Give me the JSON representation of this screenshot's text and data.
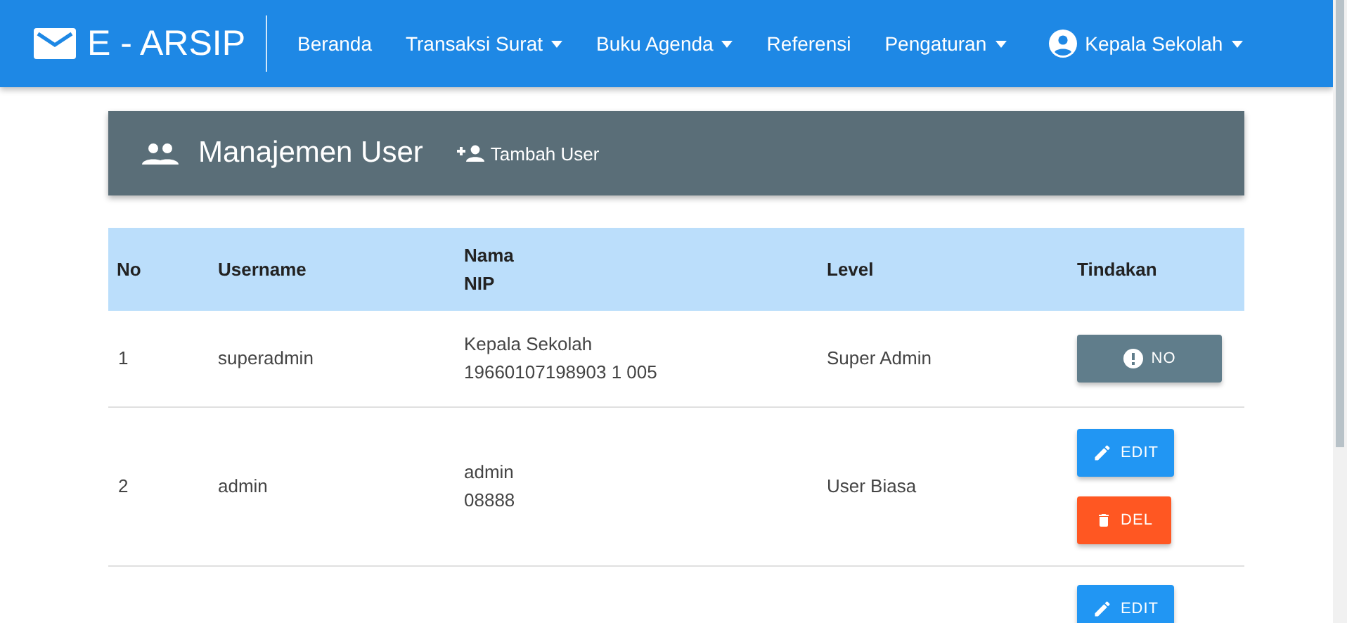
{
  "navbar": {
    "brand": "E - ARSIP",
    "menu": [
      {
        "label": "Beranda",
        "dropdown": false
      },
      {
        "label": "Transaksi Surat",
        "dropdown": true
      },
      {
        "label": "Buku Agenda",
        "dropdown": true
      },
      {
        "label": "Referensi",
        "dropdown": false
      },
      {
        "label": "Pengaturan",
        "dropdown": true
      }
    ],
    "user": {
      "label": "Kepala Sekolah",
      "dropdown": true
    }
  },
  "panel": {
    "title": "Manajemen User",
    "add_button": "Tambah User"
  },
  "table": {
    "columns": [
      "No",
      "Username",
      "Nama\nNIP",
      "Level",
      "Tindakan"
    ],
    "rows": [
      {
        "no": "1",
        "username": "superadmin",
        "nama": "Kepala Sekolah",
        "nip": "19660107198903 1 005",
        "level": "Super Admin",
        "actions": [
          {
            "kind": "no",
            "label": "NO"
          }
        ]
      },
      {
        "no": "2",
        "username": "admin",
        "nama": "admin",
        "nip": "08888",
        "level": "User Biasa",
        "actions": [
          {
            "kind": "edit",
            "label": "EDIT"
          },
          {
            "kind": "del",
            "label": "DEL"
          }
        ]
      },
      {
        "actions": [
          {
            "kind": "edit",
            "label": "EDIT"
          }
        ]
      }
    ]
  }
}
